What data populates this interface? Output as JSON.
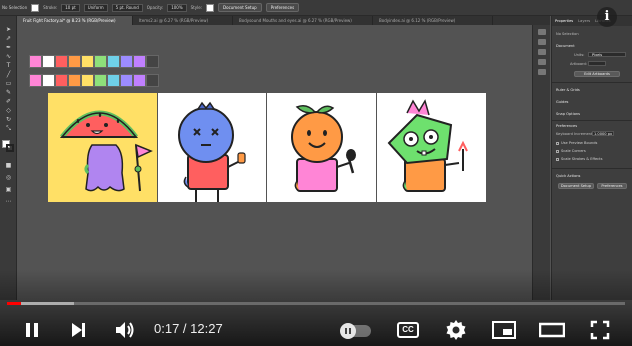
{
  "control_bar": {
    "selection": "No Selection",
    "stroke_label": "Stroke:",
    "stroke_value": "10 pt",
    "uniform": "Uniform",
    "cap": "5 pt. Round",
    "opacity_label": "Opacity:",
    "opacity_value": "100%",
    "style_label": "Style:",
    "doc_setup": "Document Setup",
    "preferences": "Preferences"
  },
  "tabs": [
    "Fruit Fight Factory.ai* @ 8.23 % (RGB/Preview)",
    "Items2.ai @ 6.27 % (RGB/Preview)",
    "Bodysound Mouths and eyes.ai @ 6.27 % (RGB/Preview)",
    "Bodyindex.ai @ 6.12 % (RGB/Preview)"
  ],
  "properties": {
    "tabs": [
      "Properties",
      "Layers",
      "Libraries"
    ],
    "no_selection": "No Selection",
    "document": "Document",
    "units_label": "Units:",
    "units_value": "Pixels",
    "artboard_label": "Artboard:",
    "edit_artboards": "Edit Artboards",
    "ruler_grids": "Ruler & Grids",
    "guides": "Guides",
    "snap_options": "Snap Options",
    "preferences": "Preferences",
    "keyboard_increment": "Keyboard Increment:",
    "keyboard_value": "1.0000 px",
    "checkboxes": [
      "Use Preview Bounds",
      "Scale Corners",
      "Scale Strokes & Effects"
    ],
    "quick_actions": "Quick Actions",
    "doc_setup_btn": "Document Setup",
    "preferences_btn": "Preferences"
  },
  "swatch_rows": [
    [
      "#ff85d6",
      "#ffffff",
      "#ff5f5f",
      "#ff9a45",
      "#ffe066",
      "#8ee07a",
      "#6fd0e8",
      "#9c8cff",
      "#c080ff",
      "#444444"
    ],
    [
      "#ff85d6",
      "#ffffff",
      "#ff5f5f",
      "#ff9a45",
      "#ffe066",
      "#8ee07a",
      "#6fd0e8",
      "#9c8cff",
      "#c080ff",
      "#444444"
    ]
  ],
  "artboard_backgrounds": [
    "#ffe066",
    "#ffffff",
    "#ffffff",
    "#ffffff"
  ],
  "characters": [
    "watermelon",
    "blueberry",
    "orange",
    "zombie lime"
  ],
  "player": {
    "current_time": "0:17",
    "separator": " / ",
    "duration": "12:27",
    "progress_fraction": 0.0229,
    "buffered_fraction": 0.108,
    "cc_label": "CC",
    "accent_color": "#ff0000"
  },
  "icons": {
    "info": "i"
  }
}
